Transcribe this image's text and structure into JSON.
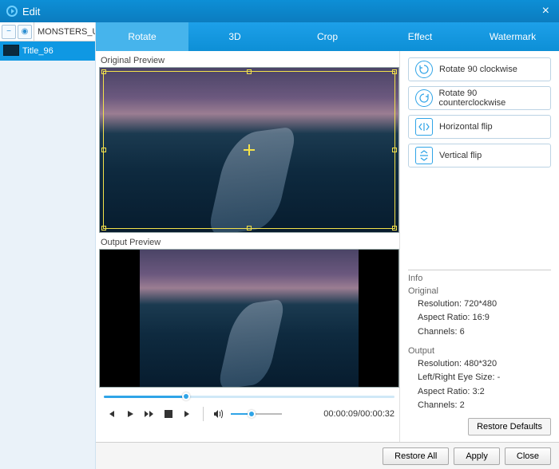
{
  "window": {
    "title": "Edit"
  },
  "sidebar": {
    "filename": "MONSTERS_U...",
    "items": [
      {
        "label": "Title_96"
      }
    ]
  },
  "tabs": [
    {
      "label": "Rotate",
      "active": true
    },
    {
      "label": "3D",
      "active": false
    },
    {
      "label": "Crop",
      "active": false
    },
    {
      "label": "Effect",
      "active": false
    },
    {
      "label": "Watermark",
      "active": false
    }
  ],
  "labels": {
    "original_preview": "Original Preview",
    "output_preview": "Output Preview"
  },
  "operations": [
    {
      "label": "Rotate 90 clockwise",
      "icon": "rotate-cw"
    },
    {
      "label": "Rotate 90 counterclockwise",
      "icon": "rotate-ccw"
    },
    {
      "label": "Horizontal flip",
      "icon": "flip-h"
    },
    {
      "label": "Vertical flip",
      "icon": "flip-v"
    }
  ],
  "playback": {
    "position": "00:00:09",
    "duration": "00:00:32",
    "time_display": "00:00:09/00:00:32"
  },
  "info": {
    "header": "Info",
    "original": {
      "label": "Original",
      "resolution_label": "Resolution:",
      "resolution": "720*480",
      "aspect_label": "Aspect Ratio:",
      "aspect": "16:9",
      "channels_label": "Channels:",
      "channels": "6"
    },
    "output": {
      "label": "Output",
      "resolution_label": "Resolution:",
      "resolution": "480*320",
      "eye_label": "Left/Right Eye Size:",
      "eye": "-",
      "aspect_label": "Aspect Ratio:",
      "aspect": "3:2",
      "channels_label": "Channels:",
      "channels": "2"
    }
  },
  "buttons": {
    "restore_defaults": "Restore Defaults",
    "restore_all": "Restore All",
    "apply": "Apply",
    "close": "Close"
  }
}
